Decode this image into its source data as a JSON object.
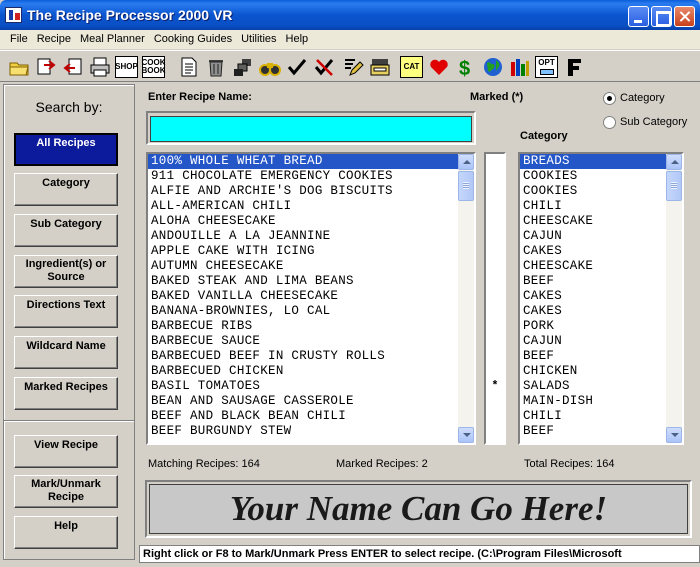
{
  "window": {
    "title": "The Recipe Processor 2000 VR"
  },
  "menu": [
    {
      "label": "File"
    },
    {
      "label": "Recipe"
    },
    {
      "label": "Meal Planner"
    },
    {
      "label": "Cooking Guides"
    },
    {
      "label": "Utilities"
    },
    {
      "label": "Help"
    }
  ],
  "toolbar": {
    "shop_label": "SHOP",
    "cookbook_label_1": "COOK",
    "cookbook_label_2": "BOOK",
    "cat_label": "CAT",
    "opt_label": "OPT",
    "icons": [
      "open-folder-icon",
      "import-icon",
      "export-icon",
      "print-icon",
      "shop-icon",
      "cookbook-icon",
      "document-icon",
      "trash-icon",
      "stack-icon",
      "binoculars-icon",
      "check-icon",
      "uncheck-icon",
      "edit-icon",
      "register-icon",
      "cat-icon",
      "heart-icon",
      "dollar-icon",
      "globe-icon",
      "chart-icon",
      "opt-icon",
      "font-icon"
    ]
  },
  "left": {
    "search_by": "Search by:",
    "buttons": [
      {
        "label": "All Recipes",
        "active": true
      },
      {
        "label": "Category"
      },
      {
        "label": "Sub Category"
      },
      {
        "label_1": "Ingredient(s) or",
        "label_2": "Source"
      },
      {
        "label": "Directions Text"
      },
      {
        "label": "Wildcard Name"
      },
      {
        "label": "Marked Recipes"
      }
    ],
    "actions": [
      {
        "label": "View Recipe"
      },
      {
        "label_1": "Mark/Unmark",
        "label_2": "Recipe"
      },
      {
        "label": "Help"
      }
    ]
  },
  "main": {
    "enter_label": "Enter Recipe Name:",
    "name_value": "",
    "marked_label": "Marked (*)",
    "category_header": "Category",
    "radio_category": "Category",
    "radio_subcategory": "Sub Category",
    "matching": "Matching Recipes: 164",
    "marked_count": "Marked Recipes: 2",
    "total": "Total Recipes: 164",
    "banner": "Your Name Can Go Here!",
    "status": "Right click or F8 to Mark/Unmark   Press ENTER to select recipe.     (C:\\Program Files\\Microsoft"
  },
  "recipes": [
    {
      "name": "100% WHOLE WHEAT BREAD",
      "category": "BREADS",
      "marked": ""
    },
    {
      "name": "911 CHOCOLATE EMERGENCY COOKIES",
      "category": "COOKIES",
      "marked": ""
    },
    {
      "name": "ALFIE AND ARCHIE'S DOG BISCUITS",
      "category": "COOKIES",
      "marked": ""
    },
    {
      "name": "ALL-AMERICAN CHILI",
      "category": "CHILI",
      "marked": ""
    },
    {
      "name": "ALOHA CHEESECAKE",
      "category": "CHEESCAKE",
      "marked": ""
    },
    {
      "name": "ANDOUILLE A LA JEANNINE",
      "category": "CAJUN",
      "marked": ""
    },
    {
      "name": "APPLE CAKE WITH ICING",
      "category": "CAKES",
      "marked": ""
    },
    {
      "name": "AUTUMN CHEESECAKE",
      "category": "CHEESCAKE",
      "marked": ""
    },
    {
      "name": "BAKED STEAK AND LIMA BEANS",
      "category": "BEEF",
      "marked": ""
    },
    {
      "name": "BAKED VANILLA CHEESECAKE",
      "category": "CAKES",
      "marked": ""
    },
    {
      "name": "BANANA-BROWNIES, LO CAL",
      "category": "CAKES",
      "marked": ""
    },
    {
      "name": "BARBECUE RIBS",
      "category": "PORK",
      "marked": ""
    },
    {
      "name": "BARBECUE SAUCE",
      "category": "CAJUN",
      "marked": ""
    },
    {
      "name": "BARBECUED BEEF IN CRUSTY ROLLS",
      "category": "BEEF",
      "marked": ""
    },
    {
      "name": "BARBECUED CHICKEN",
      "category": "CHICKEN",
      "marked": ""
    },
    {
      "name": "BASIL TOMATOES",
      "category": "SALADS",
      "marked": "*"
    },
    {
      "name": "BEAN AND SAUSAGE CASSEROLE",
      "category": "MAIN-DISH",
      "marked": ""
    },
    {
      "name": "BEEF AND BLACK BEAN CHILI",
      "category": "CHILI",
      "marked": ""
    },
    {
      "name": "BEEF BURGUNDY STEW",
      "category": "BEEF",
      "marked": ""
    }
  ]
}
